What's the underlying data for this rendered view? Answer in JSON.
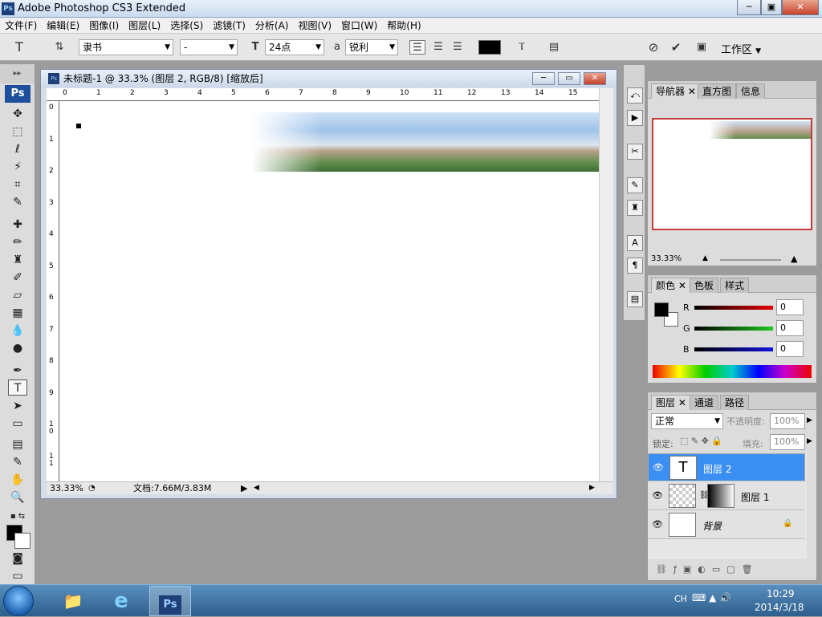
{
  "window": {
    "title": "Adobe Photoshop CS3 Extended",
    "icon": "Ps",
    "minimize": "─",
    "maximize": "▣",
    "close": "✕"
  },
  "menu": [
    "文件(F)",
    "编辑(E)",
    "图像(I)",
    "图层(L)",
    "选择(S)",
    "滤镜(T)",
    "分析(A)",
    "视图(V)",
    "窗口(W)",
    "帮助(H)"
  ],
  "options": {
    "tool_icon": "T",
    "font_family": "隶书",
    "font_style": "-",
    "font_size": "24点",
    "aa_label": "a",
    "antialias": "锐利",
    "workspace": "工作区"
  },
  "toolbox": {
    "logo": "Ps"
  },
  "document": {
    "title": "未标题-1 @ 33.3% (图层 2, RGB/8) [缩放后]",
    "zoom": "33.33%",
    "doc_info": "文档:7.66M/3.83M",
    "hruler": [
      "0",
      "1",
      "2",
      "3",
      "4",
      "5",
      "6",
      "7",
      "8",
      "9",
      "10",
      "11",
      "12",
      "13",
      "14",
      "15"
    ],
    "vruler": [
      "0",
      "1",
      "2",
      "3",
      "4",
      "5",
      "6",
      "7",
      "8",
      "9",
      "1 0",
      "1 1"
    ]
  },
  "navigator": {
    "tabs": [
      "导航器",
      "直方图",
      "信息"
    ],
    "zoom": "33.33%"
  },
  "color": {
    "tabs": [
      "颜色",
      "色板",
      "样式"
    ],
    "channels": [
      {
        "label": "R",
        "value": "0"
      },
      {
        "label": "G",
        "value": "0"
      },
      {
        "label": "B",
        "value": "0"
      }
    ]
  },
  "layers": {
    "tabs": [
      "图层",
      "通道",
      "路径"
    ],
    "blend_mode": "正常",
    "opacity_label": "不透明度:",
    "opacity": "100%",
    "lock_label": "锁定:",
    "fill_label": "填充:",
    "fill": "100%",
    "items": [
      {
        "name": "图层 2",
        "thumb": "T",
        "selected": true
      },
      {
        "name": "图层 1",
        "thumb": "",
        "selected": false
      },
      {
        "name": "背景",
        "thumb": "",
        "selected": false
      }
    ]
  },
  "taskbar": {
    "lang": "CH",
    "time": "10:29",
    "date": "2014/3/18"
  }
}
